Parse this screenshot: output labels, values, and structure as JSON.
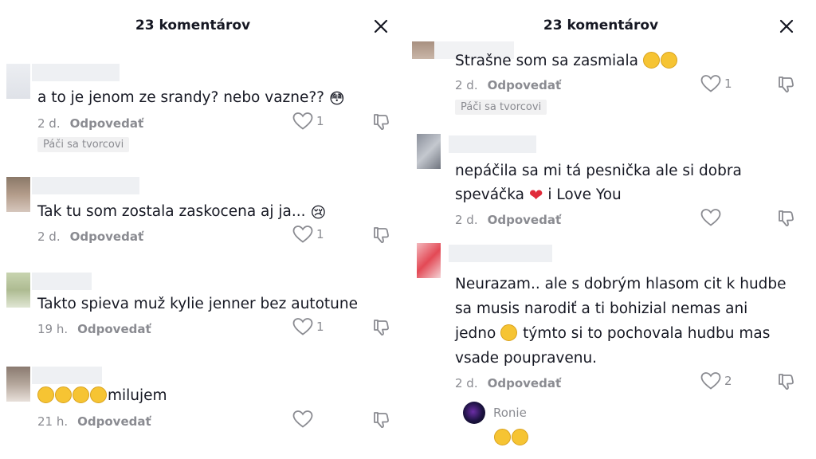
{
  "left": {
    "title": "23 komentárov",
    "comments": [
      {
        "text": "a to je jenom ze srandy? nebo vazne??",
        "emoji": "😳",
        "time": "2 d.",
        "reply": "Odpovedať",
        "likes": "1",
        "liked_by_creator": "Páči sa tvorcovi"
      },
      {
        "text": "Tak tu som zostala zaskocena aj ja...",
        "emoji": "😢",
        "time": "2 d.",
        "reply": "Odpovedať",
        "likes": "1"
      },
      {
        "text": "Takto spieva muž kylie jenner bez autotune",
        "time": "19 h.",
        "reply": "Odpovedať",
        "likes": "1"
      },
      {
        "text": "milujem",
        "time": "21 h.",
        "reply": "Odpovedať",
        "likes": ""
      }
    ]
  },
  "right": {
    "title": "23 komentárov",
    "comments": [
      {
        "text": "Strašne som sa zasmiala",
        "time": "2 d.",
        "reply": "Odpovedať",
        "likes": "1",
        "liked_by_creator": "Páči sa tvorcovi"
      },
      {
        "line1": "nepáčila sa mi tá pesnička ale si dobra",
        "line2a": "speváčka",
        "line2b": "i Love You",
        "time": "2 d.",
        "reply": "Odpovedať",
        "likes": ""
      },
      {
        "line1": "Neurazam.. ale s dobrým hlasom cit k hudbe",
        "line2": "sa musis narodiť a ti bohizial nemas ani",
        "line3a": "jedno",
        "line3b": "týmto si to pochovala hudbu mas",
        "line4": "vsade poupravenu.",
        "time": "2 d.",
        "reply": "Odpovedať",
        "likes": "2"
      }
    ],
    "reply_author": "Ronie"
  },
  "colors": {
    "text": "#161823",
    "muted": "#8a8b91",
    "badge_bg": "#f1f1f2",
    "heart": "#e02b3a",
    "emoji": "#f6c433"
  },
  "icons": [
    "close-icon",
    "heart-outline-icon",
    "dislike-icon",
    "laughing-emoji",
    "flushed-emoji",
    "crying-emoji",
    "relieved-emoji",
    "red-heart-emoji"
  ]
}
